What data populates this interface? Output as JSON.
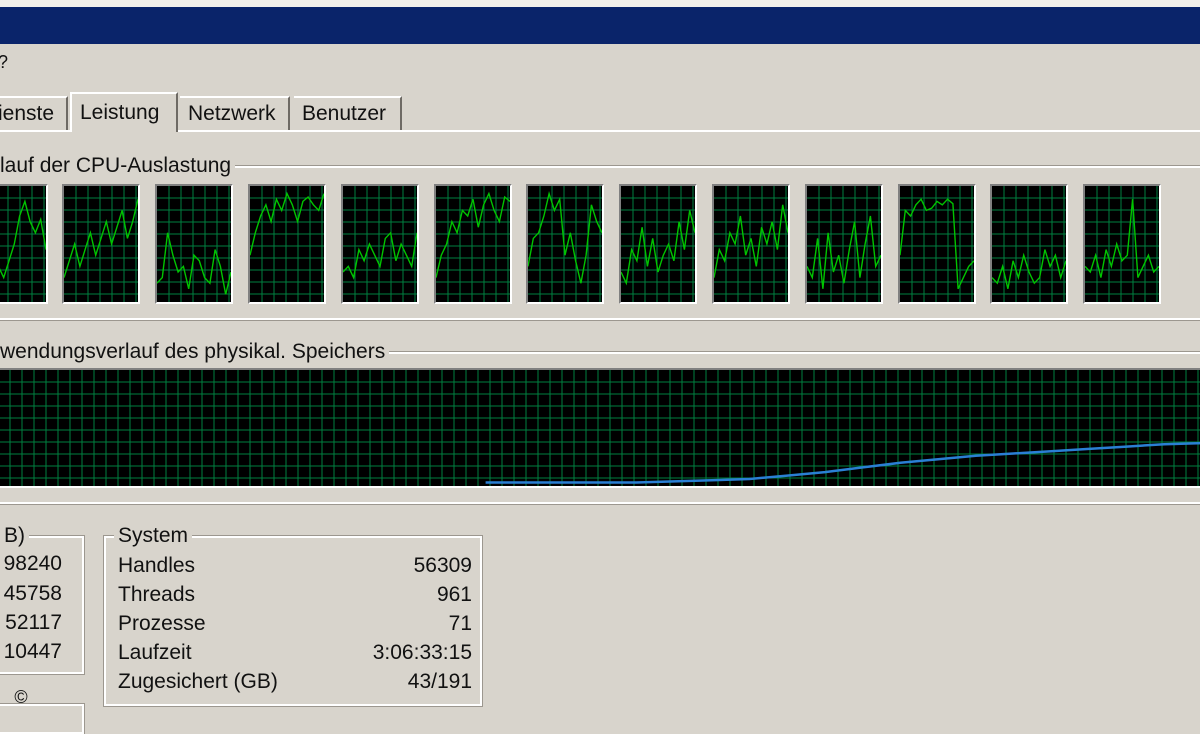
{
  "tabs": [
    {
      "label": "ienste",
      "active": false
    },
    {
      "label": "Leistung",
      "active": true
    },
    {
      "label": "Netzwerk",
      "active": false
    },
    {
      "label": "Benutzer",
      "active": false
    }
  ],
  "menu_fragment": "?",
  "cpu_history": {
    "title": "lauf der CPU-Auslastung",
    "line_color": "#00c400",
    "grid_color": "#008040",
    "core_traces": [
      [
        40,
        55,
        70,
        85,
        60,
        30,
        20,
        35,
        50,
        75,
        88,
        70,
        60,
        72,
        45
      ],
      [
        20,
        35,
        50,
        30,
        45,
        60,
        40,
        55,
        70,
        50,
        65,
        80,
        55,
        70,
        90
      ],
      [
        15,
        20,
        60,
        40,
        25,
        30,
        10,
        40,
        35,
        20,
        15,
        45,
        30,
        5,
        25
      ],
      [
        40,
        60,
        75,
        85,
        70,
        90,
        80,
        95,
        85,
        70,
        88,
        92,
        85,
        80,
        95
      ],
      [
        25,
        30,
        20,
        45,
        35,
        50,
        40,
        30,
        55,
        60,
        35,
        50,
        40,
        30,
        60
      ],
      [
        20,
        40,
        50,
        70,
        60,
        80,
        75,
        90,
        65,
        85,
        95,
        80,
        70,
        92,
        88
      ],
      [
        30,
        55,
        60,
        75,
        95,
        80,
        90,
        40,
        60,
        35,
        15,
        40,
        85,
        70,
        60
      ],
      [
        25,
        15,
        45,
        35,
        65,
        30,
        55,
        25,
        40,
        50,
        35,
        70,
        45,
        80,
        60
      ],
      [
        20,
        45,
        35,
        60,
        50,
        75,
        40,
        55,
        30,
        65,
        50,
        70,
        45,
        85,
        60
      ],
      [
        30,
        20,
        55,
        10,
        60,
        25,
        40,
        15,
        45,
        70,
        20,
        50,
        75,
        30,
        40
      ],
      [
        40,
        80,
        75,
        85,
        90,
        80,
        82,
        88,
        85,
        90,
        86,
        10,
        20,
        30,
        35
      ],
      [
        20,
        15,
        30,
        10,
        35,
        20,
        40,
        25,
        15,
        20,
        45,
        30,
        40,
        20,
        35
      ],
      [
        30,
        25,
        40,
        20,
        45,
        30,
        50,
        35,
        40,
        90,
        20,
        30,
        40,
        25,
        30
      ]
    ]
  },
  "memory_history": {
    "title": "wendungsverlauf des physikal. Speichers",
    "line_color": "#2a7fd4",
    "grid_color": "#008040",
    "usage_fraction": [
      0.03,
      0.03,
      0.03,
      0.03,
      0.03,
      0.04,
      0.05,
      0.06,
      0.09,
      0.12,
      0.16,
      0.2,
      0.23,
      0.26,
      0.28,
      0.3,
      0.32,
      0.34,
      0.36,
      0.37
    ],
    "start_fraction": 0.405
  },
  "physical_memory": {
    "title": "B)",
    "values": [
      "98240",
      "45758",
      "52117",
      "10447"
    ]
  },
  "system": {
    "title": "System",
    "rows": [
      {
        "label": "Handles",
        "value": "56309"
      },
      {
        "label": "Threads",
        "value": "961"
      },
      {
        "label": "Prozesse",
        "value": "71"
      },
      {
        "label": "Laufzeit",
        "value": "3:06:33:15"
      },
      {
        "label": "Zugesichert (GB)",
        "value": "43/191"
      }
    ]
  },
  "copyright_symbol": "©"
}
